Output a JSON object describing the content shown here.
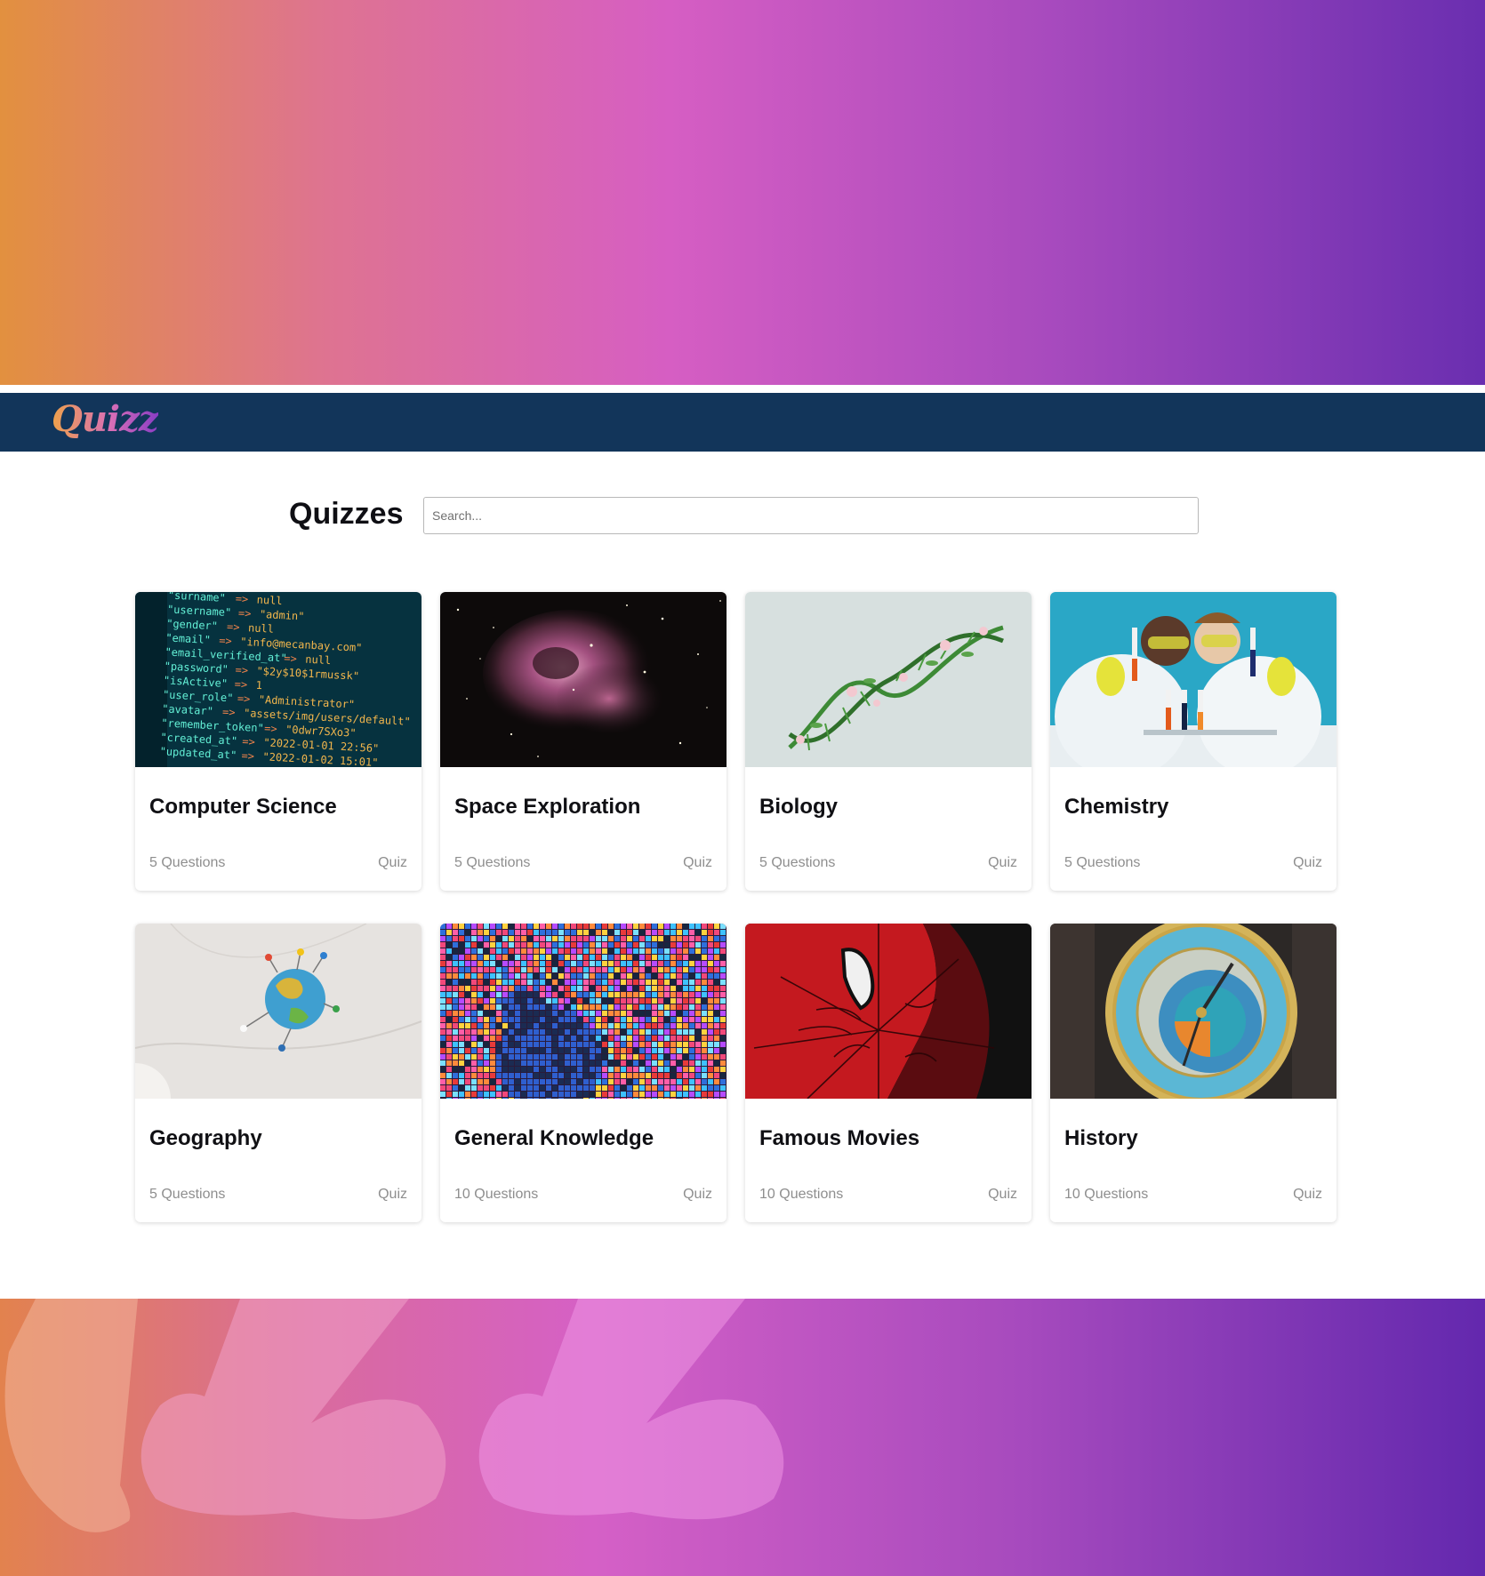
{
  "brand": {
    "logo_text": "Quizz",
    "colors": {
      "navbar": "#12355a",
      "gradient_start": "#e2903f",
      "gradient_mid": "#d65ec3",
      "gradient_end": "#6a2eb0"
    }
  },
  "main": {
    "title": "Quizzes",
    "search_placeholder": "Search..."
  },
  "quizzes": [
    {
      "title": "Computer Science",
      "questions": "5 Questions",
      "type": "Quiz",
      "image": "code-screen"
    },
    {
      "title": "Space Exploration",
      "questions": "5 Questions",
      "type": "Quiz",
      "image": "nebula"
    },
    {
      "title": "Biology",
      "questions": "5 Questions",
      "type": "Quiz",
      "image": "dna-flowers"
    },
    {
      "title": "Chemistry",
      "questions": "5 Questions",
      "type": "Quiz",
      "image": "lab-scientists"
    },
    {
      "title": "Geography",
      "questions": "5 Questions",
      "type": "Quiz",
      "image": "globe-pins"
    },
    {
      "title": "General Knowledge",
      "questions": "10 Questions",
      "type": "Quiz",
      "image": "pixel-mosaic"
    },
    {
      "title": "Famous Movies",
      "questions": "10 Questions",
      "type": "Quiz",
      "image": "spiderman-mask"
    },
    {
      "title": "History",
      "questions": "10 Questions",
      "type": "Quiz",
      "image": "astronomical-clock"
    }
  ]
}
